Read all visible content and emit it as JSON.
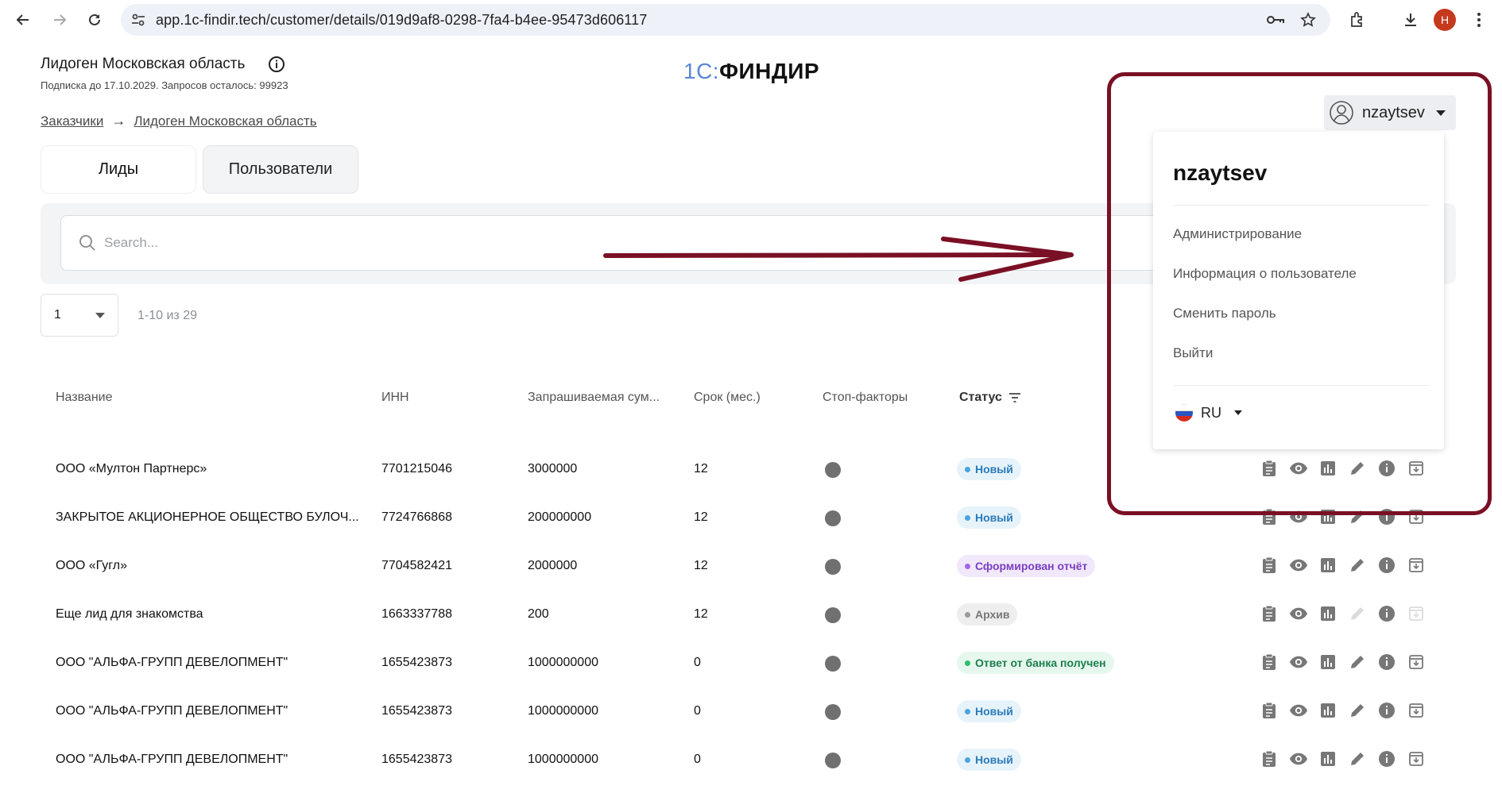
{
  "browser": {
    "url": "app.1c-findir.tech/customer/details/019d9af8-0298-7fa4-b4ee-95473d606117",
    "profile_initial": "Н"
  },
  "header": {
    "customer_title": "Лидоген Московская область",
    "subscription": "Подписка до 17.10.2029. Запросов осталось: 99923",
    "logo_1c": "1С:",
    "logo_findir": "ФИНДИР"
  },
  "breadcrumb": {
    "customers": "Заказчики",
    "arrow": "→",
    "current": "Лидоген Московская область"
  },
  "tabs": {
    "leads": "Лиды",
    "users": "Пользователи"
  },
  "search": {
    "placeholder": "Search..."
  },
  "pagination": {
    "page_size": "1",
    "range": "1-10 из 29"
  },
  "table": {
    "headers": {
      "name": "Название",
      "inn": "ИНН",
      "sum": "Запрашиваемая сум...",
      "term": "Срок (мес.)",
      "stop": "Стоп-факторы",
      "status": "Статус"
    },
    "rows": [
      {
        "name": "ООО «Мултон Партнерс»",
        "inn": "7701215046",
        "sum": "3000000",
        "term": "12",
        "status": "Новый",
        "status_kind": "new"
      },
      {
        "name": "ЗАКРЫТОЕ АКЦИОНЕРНОЕ ОБЩЕСТВО БУЛОЧ...",
        "inn": "7724766868",
        "sum": "200000000",
        "term": "12",
        "status": "Новый",
        "status_kind": "new"
      },
      {
        "name": "ООО «Гугл»",
        "inn": "7704582421",
        "sum": "2000000",
        "term": "12",
        "status": "Сформирован отчёт",
        "status_kind": "report"
      },
      {
        "name": "Еще лид для знакомства",
        "inn": "1663337788",
        "sum": "200",
        "term": "12",
        "status": "Архив",
        "status_kind": "archive"
      },
      {
        "name": "ООО \"АЛЬФА-ГРУПП ДЕВЕЛОПМЕНТ\"",
        "inn": "1655423873",
        "sum": "1000000000",
        "term": "0",
        "status": "Ответ от банка получен",
        "status_kind": "bank"
      },
      {
        "name": "ООО \"АЛЬФА-ГРУПП ДЕВЕЛОПМЕНТ\"",
        "inn": "1655423873",
        "sum": "1000000000",
        "term": "0",
        "status": "Новый",
        "status_kind": "new"
      },
      {
        "name": "ООО \"АЛЬФА-ГРУПП ДЕВЕЛОПМЕНТ\"",
        "inn": "1655423873",
        "sum": "1000000000",
        "term": "0",
        "status": "Новый",
        "status_kind": "new"
      }
    ]
  },
  "user_menu": {
    "username": "nzaytsev",
    "items": [
      "Администрирование",
      "Информация о пользователе",
      "Сменить пароль",
      "Выйти"
    ],
    "language": "RU"
  },
  "colors": {
    "annotation": "#7a1025",
    "status_new_bg": "#e6f3fb",
    "status_new_fg": "#2b7bb9",
    "status_new_dot": "#4aa3df",
    "status_report_bg": "#f1e8fb",
    "status_report_fg": "#7a3fc1",
    "status_report_dot": "#a366e6",
    "status_archive_bg": "#eeeeee",
    "status_archive_fg": "#777777",
    "status_archive_dot": "#999999",
    "status_bank_bg": "#e6f7ee",
    "status_bank_fg": "#1c7f4a",
    "status_bank_dot": "#2bbf6c"
  },
  "icons": {
    "row_actions": [
      "clipboard-icon",
      "eye-icon",
      "bar-chart-icon",
      "pencil-icon",
      "info-icon",
      "archive-icon"
    ]
  }
}
